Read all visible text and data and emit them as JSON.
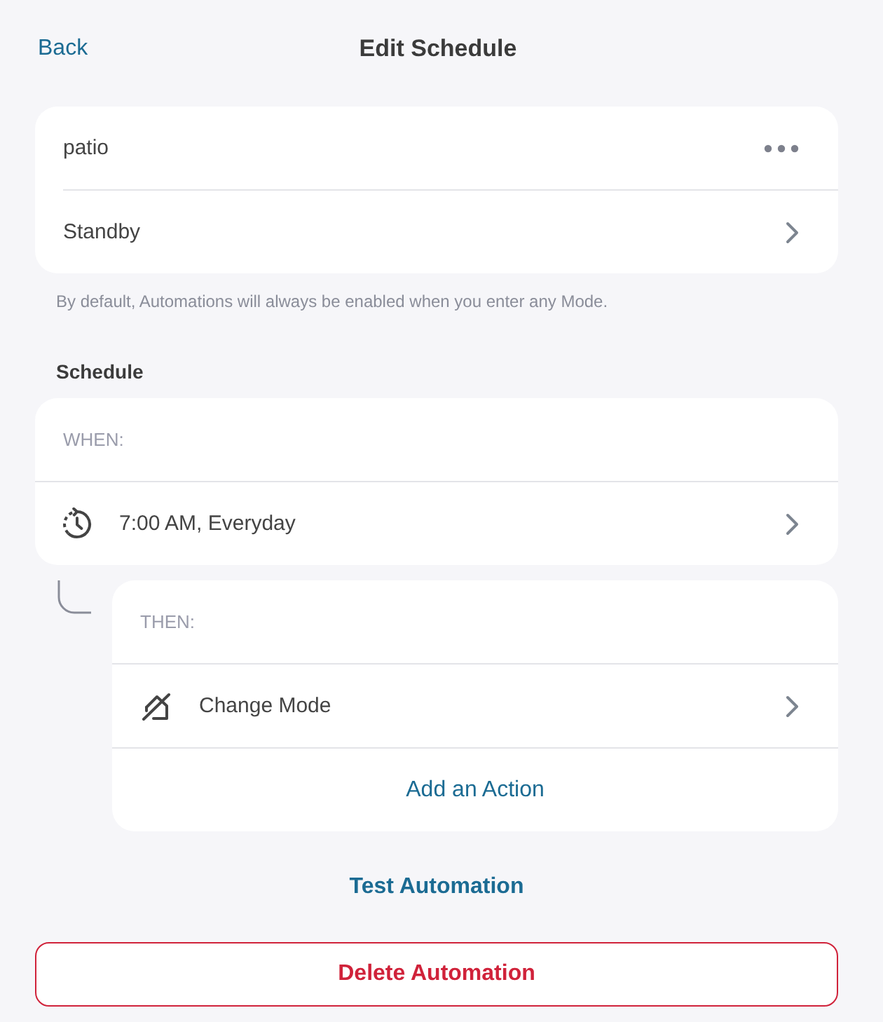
{
  "header": {
    "back": "Back",
    "title": "Edit Schedule"
  },
  "automation": {
    "rows": [
      {
        "kind": "name",
        "label": "patio"
      },
      {
        "kind": "option",
        "label": "Standby"
      }
    ],
    "note": "By default, Automations will always be enabled when you enter any Mode."
  },
  "schedule": {
    "heading": "Schedule",
    "when": {
      "label": "WHEN:",
      "items": [
        {
          "kind": "time",
          "label": "7:00 AM, Everyday"
        }
      ]
    },
    "then": {
      "label": "THEN:",
      "items": [
        {
          "kind": "mode",
          "label": "Change Mode"
        }
      ],
      "add_button": "Add an Action"
    }
  },
  "test_button": "Test Automation",
  "delete_button": "Delete Automation"
}
